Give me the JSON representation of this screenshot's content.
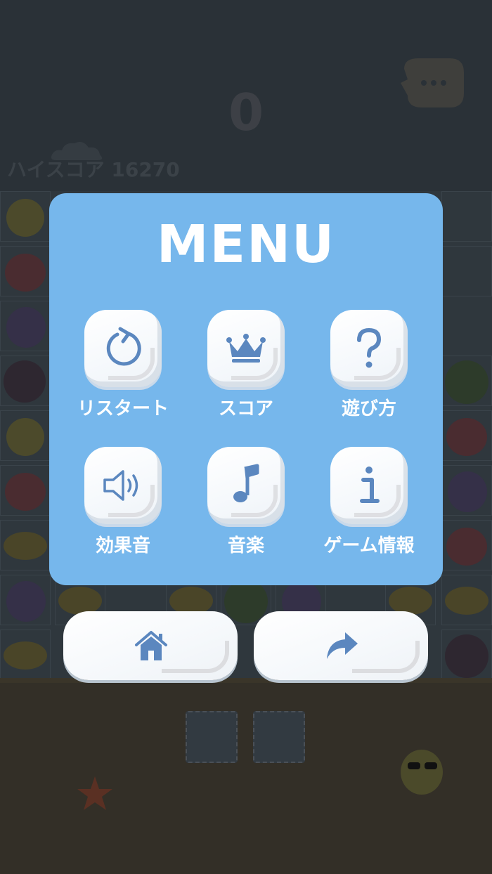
{
  "game": {
    "score": "0",
    "highscore_label": "ハイスコア 16270"
  },
  "menu": {
    "title": "MENU",
    "items": [
      {
        "label": "リスタート",
        "icon": "restart-icon"
      },
      {
        "label": "スコア",
        "icon": "crown-icon"
      },
      {
        "label": "遊び方",
        "icon": "question-icon"
      },
      {
        "label": "効果音",
        "icon": "speaker-icon"
      },
      {
        "label": "音楽",
        "icon": "music-note-icon"
      },
      {
        "label": "ゲーム情報",
        "icon": "info-icon"
      }
    ]
  },
  "bottom_buttons": [
    {
      "icon": "home-icon"
    },
    {
      "icon": "share-icon"
    }
  ],
  "colors": {
    "panel": "#76b7ec",
    "icon": "#5b87bf",
    "button_face": "#f7fafd"
  }
}
